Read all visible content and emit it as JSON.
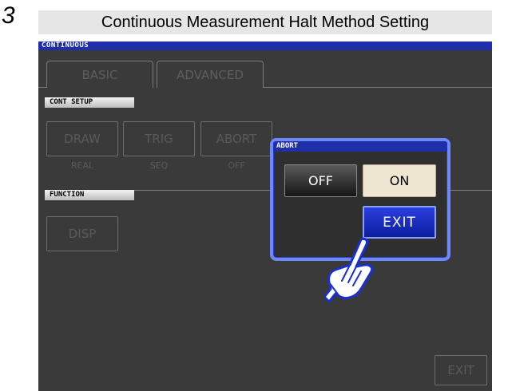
{
  "step": {
    "number": "3",
    "heading": "Continuous Measurement Halt Method Setting"
  },
  "screen": {
    "title": "CONTINUOUS",
    "tabs": [
      {
        "label": "BASIC"
      },
      {
        "label": "ADVANCED"
      }
    ],
    "cont_setup": {
      "label": "CONT SETUP",
      "buttons": [
        {
          "label": "DRAW",
          "value": "REAL"
        },
        {
          "label": "TRIG",
          "value": "SEQ"
        },
        {
          "label": "ABORT",
          "value": "OFF"
        }
      ]
    },
    "function": {
      "label": "FUNCTION",
      "buttons": [
        {
          "label": "DISP"
        }
      ]
    },
    "exit_label": "EXIT"
  },
  "popup": {
    "title": "ABORT",
    "off_label": "OFF",
    "on_label": "ON",
    "exit_label": "EXIT"
  },
  "colors": {
    "screen_bg": "#3a3a3a",
    "title_strip": "#1f2faa",
    "popup_border": "#6e88ff",
    "on_button": "#efe6d1",
    "exit_button": "#1f35d0"
  },
  "icons": {
    "pointer": "pointing-hand-icon"
  }
}
